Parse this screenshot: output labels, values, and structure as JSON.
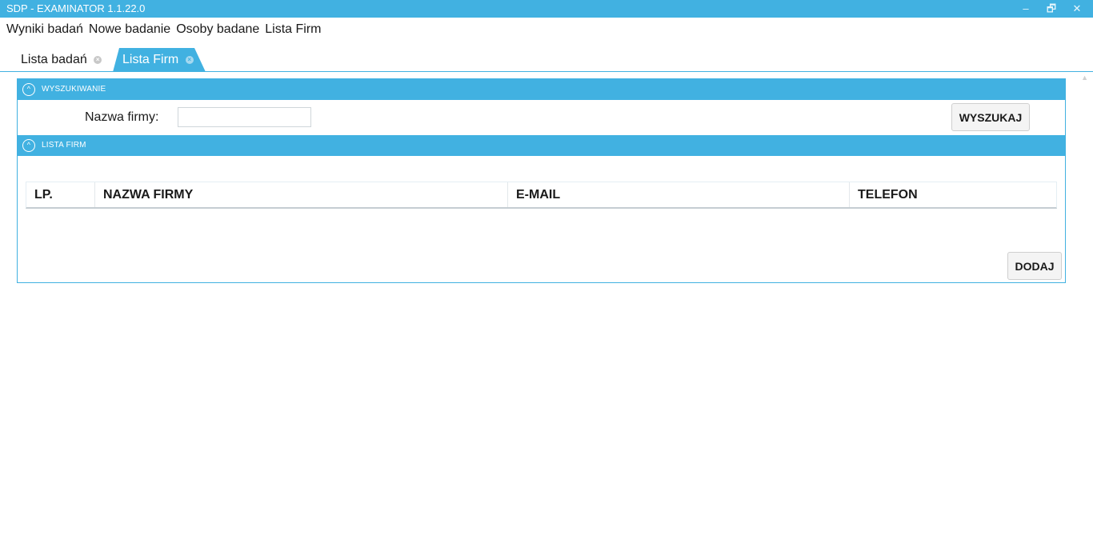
{
  "window": {
    "title": "SDP - EXAMINATOR 1.1.22.0",
    "controls": {
      "minimize": "–",
      "restore": "🗗",
      "close": "✕"
    }
  },
  "menu": {
    "items": [
      {
        "label": "Wyniki badań"
      },
      {
        "label": "Nowe badanie"
      },
      {
        "label": "Osoby badane"
      },
      {
        "label": "Lista Firm"
      }
    ]
  },
  "tabs": [
    {
      "label": "Lista badań",
      "active": false
    },
    {
      "label": "Lista Firm",
      "active": true
    }
  ],
  "search_section": {
    "header": "WYSZUKIWANIE",
    "company_label": "Nazwa firmy:",
    "company_value": "",
    "search_button": "WYSZUKAJ"
  },
  "list_section": {
    "header": "LISTA FIRM",
    "columns": [
      "LP.",
      "NAZWA FIRMY",
      "E-MAIL",
      "TELEFON"
    ],
    "rows": [],
    "add_button": "DODAJ"
  },
  "colors": {
    "accent": "#41b1e1"
  },
  "icons": {
    "collapse": "chevron-up-circle-icon",
    "tab_close": "close-circle-icon"
  }
}
